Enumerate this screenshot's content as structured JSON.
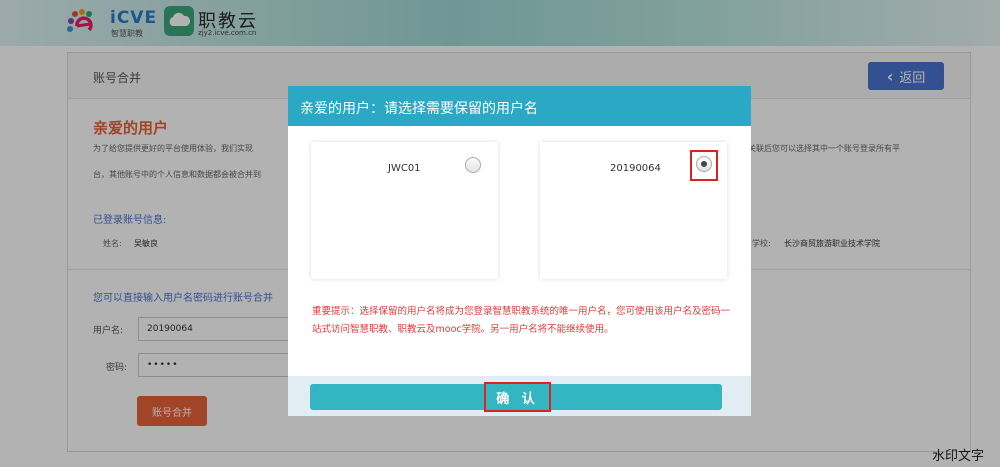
{
  "header": {
    "logo1_text": "iCVE",
    "logo1_sub": "智慧职教",
    "logo2_text": "职教云",
    "logo2_sub": "zjy2.icve.com.cn"
  },
  "page": {
    "title": "账号合并",
    "back_label": "返回",
    "greeting": "亲爱的用户",
    "intro_line1": "为了给您提供更好的平台使用体验，我们实现",
    "intro_line1_right": "关联后您可以选择其中一个账号登录所有平",
    "intro_line2": "台，其他账号中的个人信息和数据都会被合并到",
    "logged_info_title": "已登录账号信息:",
    "name_label": "姓名:",
    "name_value": "吴敏良",
    "school_label": "学校:",
    "school_value": "长沙商贸旅游职业技术学院",
    "merge_section_title": "您可以直接输入用户名密码进行账号合并",
    "username_label": "用户名:",
    "username_value": "20190064",
    "password_label": "密码:",
    "password_value": "•••••",
    "merge_button": "账号合并"
  },
  "modal": {
    "title": "亲爱的用户：请选择需要保留的用户名",
    "options": [
      {
        "name": "JWC01",
        "selected": false
      },
      {
        "name": "20190064",
        "selected": true
      }
    ],
    "note": "重要提示：选择保留的用户名将成为您登录智慧职教系统的唯一用户名，您可使用该用户名及密码一站式访问智慧职教、职教云及mooc学院。另一用户名将不能继续使用。",
    "confirm_label": "确 认"
  },
  "watermark": "水印文字",
  "colors": {
    "accent_blue": "#4a74cf",
    "modal_header": "#2aa8c4",
    "confirm_button": "#34b5c2",
    "orange": "#e8623a",
    "warning_red": "#e03a3a",
    "highlight_red": "#e02020"
  }
}
